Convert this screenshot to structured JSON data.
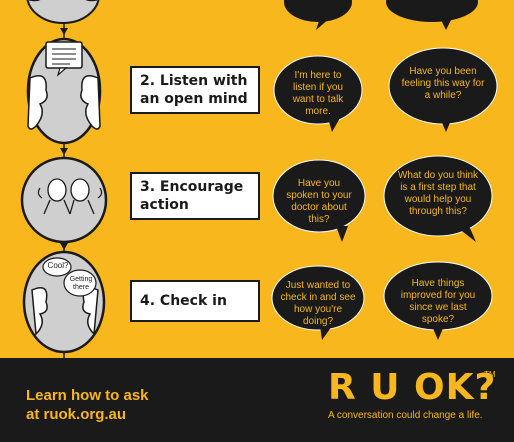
{
  "steps": [
    {
      "label": "2. Listen with an open mind",
      "bubble_left": "I'm here to listen if you want to talk more.",
      "bubble_right": "Have you been feeling this way for a while?"
    },
    {
      "label": "3. Encourage action",
      "bubble_left": "Have you spoken to your doctor about this?",
      "bubble_right": "What do you think is a first step that would help you through this?"
    },
    {
      "label": "4. Check in",
      "bubble_left": "Just wanted to check in and see how you're doing?",
      "bubble_right": "Have things improved for you since we last spoke?"
    }
  ],
  "mini_bubbles": {
    "cool": "Cool?",
    "getting_there": "Getting there"
  },
  "footer": {
    "learn_line1": "Learn how to ask",
    "learn_line2_prefix": "at ",
    "learn_url": "ruok.org.au",
    "logo": "R U OK?",
    "trademark": "TM",
    "tagline": "A conversation could change a life."
  },
  "colors": {
    "background": "#f7b71d",
    "dark": "#1a1a1a",
    "white": "#ffffff"
  }
}
